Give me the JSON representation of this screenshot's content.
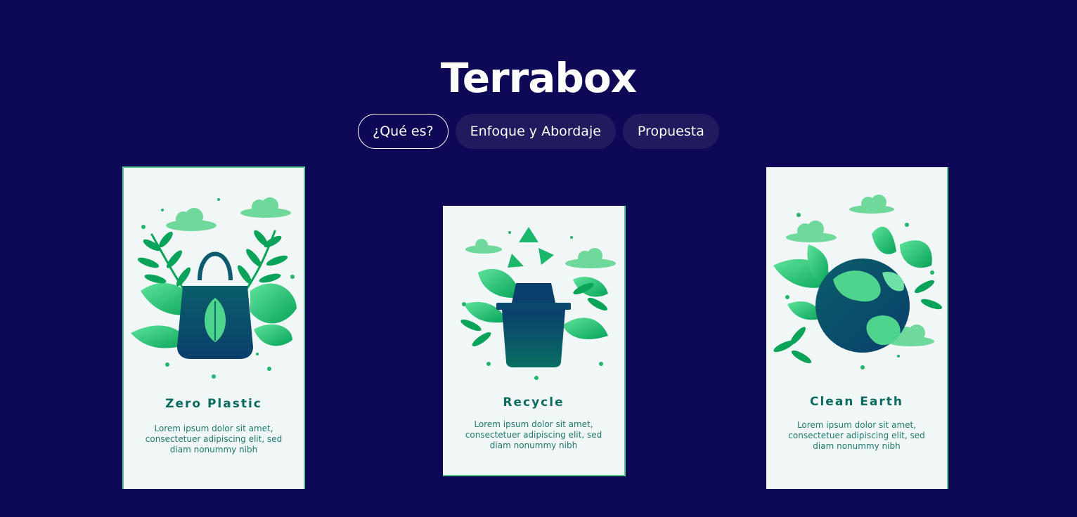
{
  "header": {
    "title": "Terrabox"
  },
  "nav": {
    "tabs": [
      {
        "label": "¿Qué es?",
        "active": true
      },
      {
        "label": "Enfoque y Abordaje",
        "active": false
      },
      {
        "label": "Propuesta",
        "active": false
      }
    ]
  },
  "cards": [
    {
      "title": "Zero Plastic",
      "text": "Lorem ipsum dolor sit amet, consectetuer adipiscing elit, sed diam nonummy nibh",
      "icon": "tote-bag-leaf-icon"
    },
    {
      "title": "Recycle",
      "text": "Lorem ipsum dolor sit amet, consectetuer adipiscing elit, sed diam nonummy nibh",
      "icon": "recycle-bin-icon"
    },
    {
      "title": "Clean Earth",
      "text": "Lorem ipsum dolor sit amet, consectetuer adipiscing elit, sed diam nonummy nibh",
      "icon": "earth-globe-icon"
    }
  ],
  "colors": {
    "background": "#0e0956",
    "pill": "#1f1b5e",
    "card": "#f1f6f6",
    "accent_green": "#2fd27a",
    "text_green": "#0c6b60"
  }
}
